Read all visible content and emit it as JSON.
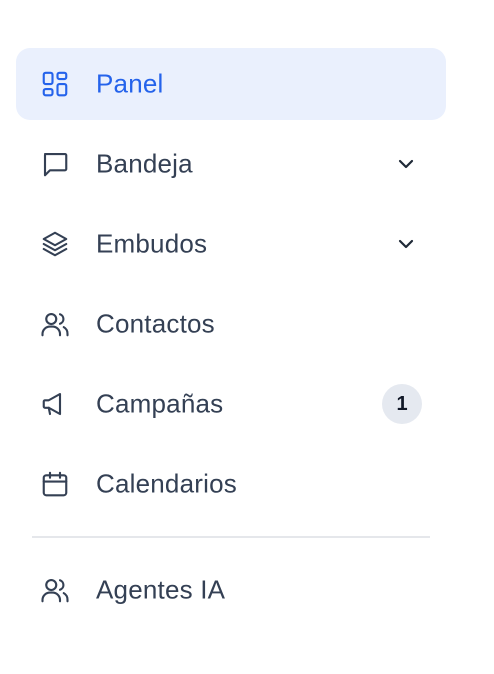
{
  "nav": {
    "items": [
      {
        "label": "Panel",
        "icon": "dashboard-grid-icon",
        "active": true
      },
      {
        "label": "Bandeja",
        "icon": "message-square-icon",
        "expandable": true
      },
      {
        "label": "Embudos",
        "icon": "layers-icon",
        "expandable": true
      },
      {
        "label": "Contactos",
        "icon": "users-icon"
      },
      {
        "label": "Campañas",
        "icon": "megaphone-icon",
        "badge": "1"
      },
      {
        "label": "Calendarios",
        "icon": "calendar-icon"
      }
    ],
    "secondary_items": [
      {
        "label": "Agentes IA",
        "icon": "users-icon"
      }
    ]
  },
  "colors": {
    "active_bg": "#eaf0fd",
    "active_text": "#2563eb",
    "text": "#344054",
    "badge_bg": "#e5e9f0"
  }
}
